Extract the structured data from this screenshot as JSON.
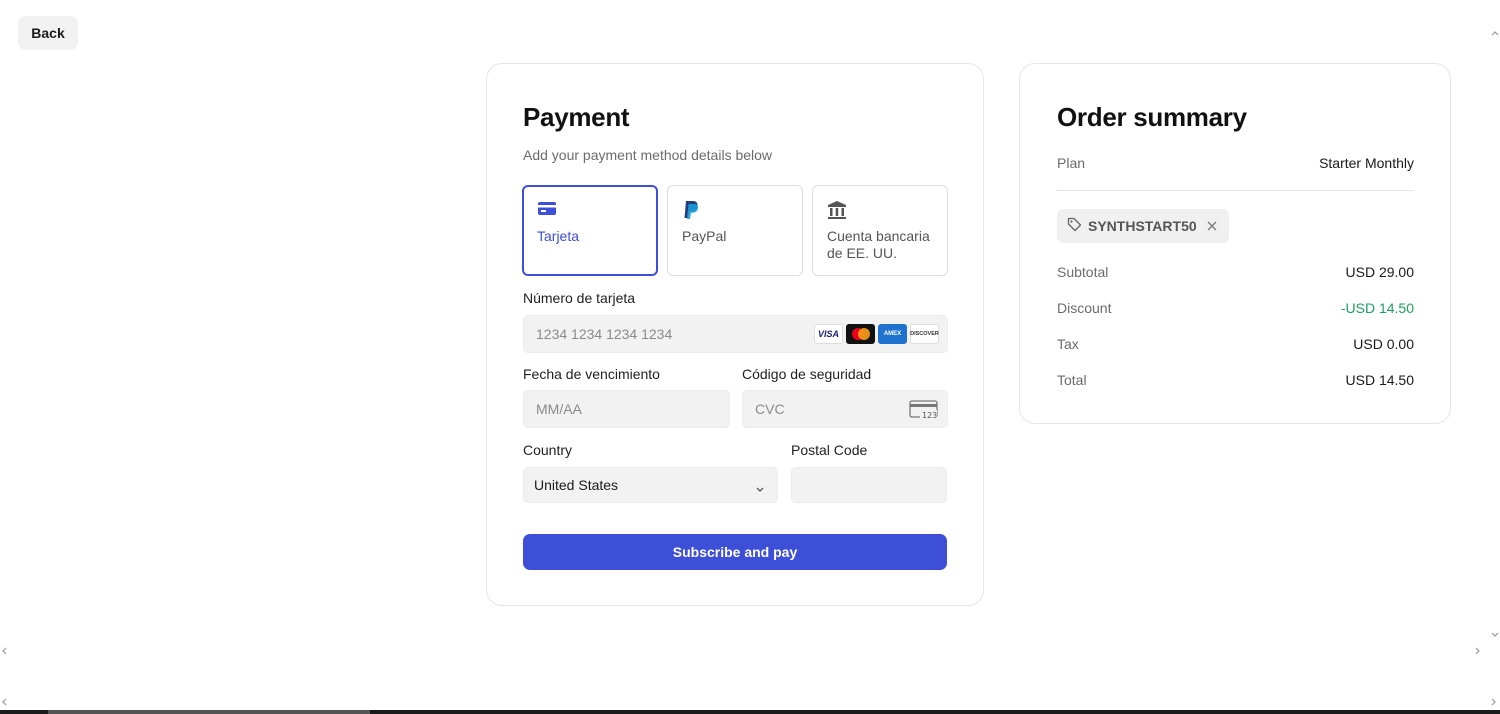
{
  "back_label": "Back",
  "payment": {
    "title": "Payment",
    "subtitle": "Add your payment method details below",
    "methods": [
      {
        "label": "Tarjeta",
        "icon": "credit-card-icon"
      },
      {
        "label": "PayPal",
        "icon": "paypal-icon"
      },
      {
        "label": "Cuenta bancaria de EE. UU.",
        "icon": "bank-icon"
      }
    ],
    "card_number_label": "Número de tarjeta",
    "card_number_placeholder": "1234 1234 1234 1234",
    "card_brands": [
      "VISA",
      "Mastercard",
      "AMEX",
      "DISCOVER"
    ],
    "expiry_label": "Fecha de vencimiento",
    "expiry_placeholder": "MM/AA",
    "cvc_label": "Código de seguridad",
    "cvc_placeholder": "CVC",
    "cvc_icon_text": "123",
    "country_label": "Country",
    "country_value": "United States",
    "postal_label": "Postal Code",
    "postal_value": "",
    "submit_label": "Subscribe and pay",
    "accent_color": "#3d4fd6"
  },
  "summary": {
    "title": "Order summary",
    "plan_label": "Plan",
    "plan_value": "Starter Monthly",
    "coupon_code": "SYNTHSTART50",
    "rows": [
      {
        "label": "Subtotal",
        "value": "USD 29.00"
      },
      {
        "label": "Discount",
        "value": "-USD 14.50"
      },
      {
        "label": "Tax",
        "value": "USD 0.00"
      },
      {
        "label": "Total",
        "value": "USD 14.50"
      }
    ],
    "discount_color": "#1e9e62"
  }
}
